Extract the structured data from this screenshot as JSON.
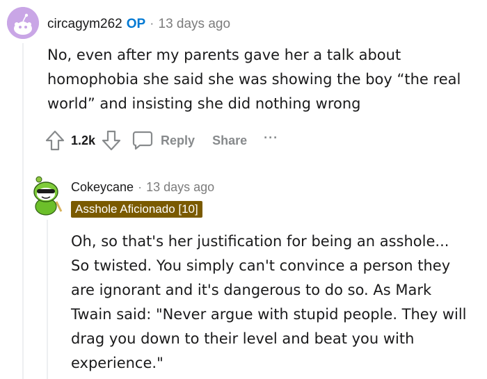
{
  "comment1": {
    "author": "circagym262",
    "op_badge": "OP",
    "separator": "·",
    "time": "13 days ago",
    "body": "No, even after my parents gave her a talk about homophobia she said she was showing the boy “the real world” and insisting she did nothing wrong",
    "body_lines": [
      "No, even after my parents gave her a talk about",
      "homophobia she said she was showing the boy “the real",
      "world” and insisting she did nothing wrong"
    ],
    "score": "1.2k",
    "reply_label": "Reply",
    "share_label": "Share",
    "more_label": "···",
    "icons": [
      "upvote-icon",
      "downvote-icon",
      "comment-icon",
      "more-icon"
    ]
  },
  "comment2": {
    "author": "Cokeycane",
    "separator": "·",
    "time": "13 days ago",
    "flair": "Asshole Aficionado [10]",
    "body_lines": [
      "Oh, so that's her justification for being an asshole...",
      "So twisted. You simply can't convince a person they",
      "are ignorant and it's dangerous to do so. As Mark",
      "Twain said: \"Never argue with stupid people. They will",
      "drag you down to their level and beat you with",
      "experience.\""
    ]
  },
  "colors": {
    "op": "#0079d3",
    "flair_bg": "#7a5a00",
    "muted": "#878a8c",
    "avatar1_bg": "#c9a6e6"
  }
}
